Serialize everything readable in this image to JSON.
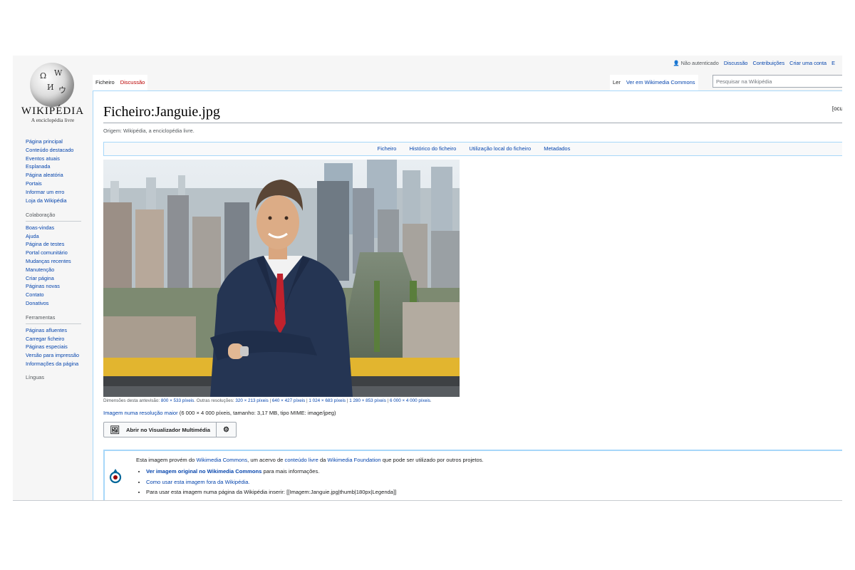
{
  "personal": {
    "not_logged": "Não autenticado",
    "talk": "Discussão",
    "contributions": "Contribuições",
    "create_account": "Criar uma conta",
    "truncated": "E"
  },
  "logo": {
    "wordmark": "WIKIPÉDIA",
    "tagline": "A enciclopédia livre"
  },
  "tabs": {
    "file": "Ficheiro",
    "discussion": "Discussão",
    "read": "Ler",
    "commons": "Ver em Wikimedia Commons"
  },
  "search": {
    "placeholder": "Pesquisar na Wikipédia"
  },
  "sidebar": {
    "nav": [
      "Página principal",
      "Conteúdo destacado",
      "Eventos atuais",
      "Esplanada",
      "Página aleatória",
      "Portais",
      "Informar um erro",
      "Loja da Wikipédia"
    ],
    "collab_heading": "Colaboração",
    "collab": [
      "Boas-vindas",
      "Ajuda",
      "Página de testes",
      "Portal comunitário",
      "Mudanças recentes",
      "Manutenção",
      "Criar página",
      "Páginas novas",
      "Contato",
      "Donativos"
    ],
    "tools_heading": "Ferramentas",
    "tools": [
      "Páginas afluentes",
      "Carregar ficheiro",
      "Páginas especiais",
      "Versão para impressão",
      "Informações da página"
    ],
    "languages": "Línguas"
  },
  "page": {
    "title": "Ficheiro:Janguie.jpg",
    "hide": "[ocu",
    "origin": "Origem: Wikipédia, a enciclopédia livre."
  },
  "filetoc": [
    "Ficheiro",
    "Histórico do ficheiro",
    "Utilização local do ficheiro",
    "Metadados"
  ],
  "dims": {
    "prefix": "Dimensões desta antevisão:",
    "preview": "800 × 533 píxeis",
    "others": ". Outras resoluções:",
    "r1": "320 × 213 píxeis",
    "r2": "640 × 427 píxeis",
    "r3": "1 024 × 683 píxeis",
    "r4": "1 280 × 853 píxeis",
    "r5": "6 000 × 4 000 píxeis",
    "sep": " | ",
    "end": "."
  },
  "fullres": {
    "link": "Imagem numa resolução maior",
    "details": "(6 000 × 4 000 píxeis, tamanho: 3,17 MB, tipo MIME: image/jpeg)"
  },
  "mmv": {
    "label": "Abrir no Visualizador Multimédia"
  },
  "commons": {
    "intro_a": "Esta imagem provém do",
    "wc": "Wikimedia Commons",
    "intro_b": ", um acervo de",
    "free": "conteúdo livre",
    "intro_c": "da",
    "wf": "Wikimedia Foundation",
    "intro_d": "que pode ser utilizado por outros projetos.",
    "b1_link": "Ver imagem original no Wikimedia Commons",
    "b1_rest": " para mais informações.",
    "b2_link": "Como usar esta imagem fora da Wikipédia.",
    "b3": "Para usar esta imagem numa página da Wikipédia inserir: [[Imagem:Janguie.jpg|thumb|180px|Legenda]]"
  }
}
